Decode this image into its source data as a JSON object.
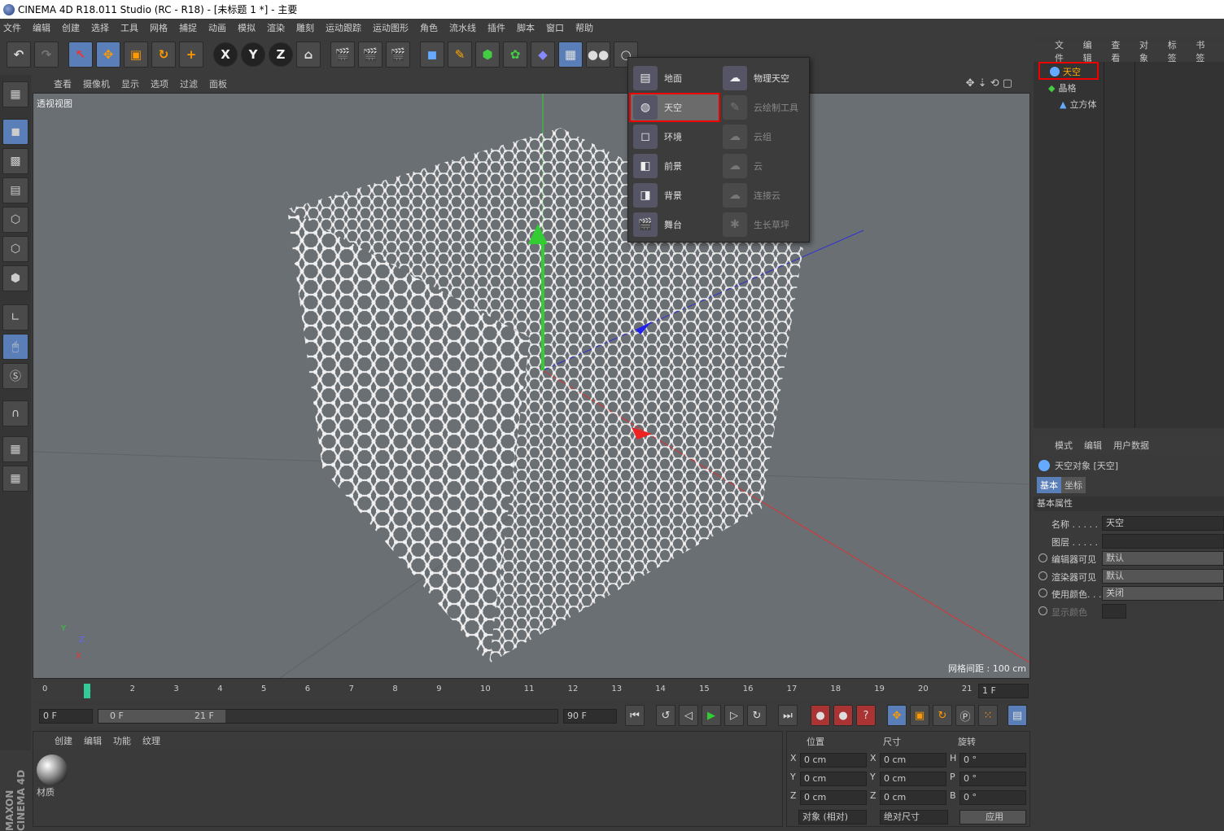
{
  "title": "CINEMA 4D R18.011 Studio (RC - R18) - [未标题 1 *] - 主要",
  "menu": [
    "文件",
    "编辑",
    "创建",
    "选择",
    "工具",
    "网格",
    "捕捉",
    "动画",
    "模拟",
    "渲染",
    "雕刻",
    "运动跟踪",
    "运动图形",
    "角色",
    "流水线",
    "插件",
    "脚本",
    "窗口",
    "帮助"
  ],
  "toolbar": {
    "axis_x": "X",
    "axis_y": "Y",
    "axis_z": "Z"
  },
  "viewport": {
    "menu": [
      "查看",
      "摄像机",
      "显示",
      "选项",
      "过滤",
      "面板"
    ],
    "label": "透视视图",
    "grid_info": "网格间距 : 100 cm",
    "axis_y": "Y",
    "axis_z": "Z",
    "axis_x": "X"
  },
  "timeline": {
    "ticks": [
      "0",
      "1",
      "2",
      "3",
      "4",
      "5",
      "6",
      "7",
      "8",
      "9",
      "10",
      "11",
      "12",
      "13",
      "14",
      "15",
      "16",
      "17",
      "18",
      "19",
      "20",
      "21"
    ],
    "current": "1 F"
  },
  "anim": {
    "start": "0 F",
    "range_start": "0 F",
    "range_end": "21 F",
    "end": "90 F"
  },
  "material_panel": {
    "menu": [
      "创建",
      "编辑",
      "功能",
      "纹理"
    ],
    "material_name": "材质"
  },
  "coords": {
    "headers": [
      "位置",
      "尺寸",
      "旋转"
    ],
    "rows": [
      {
        "a": "X",
        "pos": "0 cm",
        "b": "X",
        "size": "0 cm",
        "c": "H",
        "rot": "0 °"
      },
      {
        "a": "Y",
        "pos": "0 cm",
        "b": "Y",
        "size": "0 cm",
        "c": "P",
        "rot": "0 °"
      },
      {
        "a": "Z",
        "pos": "0 cm",
        "b": "Z",
        "size": "0 cm",
        "c": "B",
        "rot": "0 °"
      }
    ],
    "mode": "对象 (相对)",
    "size_mode": "绝对尺寸",
    "apply": "应用"
  },
  "brand": "MAXON CINEMA 4D",
  "object_manager": {
    "menu": [
      "文件",
      "编辑",
      "查看",
      "对象",
      "标签",
      "书签"
    ],
    "objects": [
      "天空",
      "晶格",
      "立方体"
    ]
  },
  "attributes": {
    "menu": [
      "模式",
      "编辑",
      "用户数据"
    ],
    "object_title": "天空对象 [天空]",
    "tabs": [
      "基本",
      "坐标"
    ],
    "section": "基本属性",
    "fields": [
      {
        "label": "名称 . . . . .",
        "value": "天空"
      },
      {
        "label": "图层 . . . . .",
        "value": ""
      },
      {
        "label": "编辑器可见",
        "value": "默认"
      },
      {
        "label": "渲染器可见",
        "value": "默认"
      },
      {
        "label": "使用颜色. . .",
        "value": "关闭"
      },
      {
        "label": "显示颜色",
        "value": ""
      }
    ]
  },
  "dropdown": {
    "left": [
      "地面",
      "天空",
      "环境",
      "前景",
      "背景",
      "舞台"
    ],
    "right": [
      "物理天空",
      "云绘制工具",
      "云组",
      "云",
      "连接云",
      "生长草坪"
    ]
  }
}
